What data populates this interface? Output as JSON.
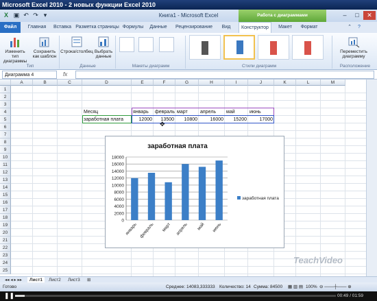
{
  "player": {
    "title": "Microsoft Excel 2010 - 2 новых функции Excel 2010",
    "progress": 0.03,
    "time_current": "00:49",
    "time_total": "01:59",
    "watermark": "TeachVideo"
  },
  "window": {
    "title": "Книга1 - Microsoft Excel",
    "context_tab": "Работа с диаграммами"
  },
  "tabs": {
    "file": "Файл",
    "items": [
      "Главная",
      "Вставка",
      "Разметка страницы",
      "Формулы",
      "Данные",
      "Рецензирование",
      "Вид",
      "Конструктор",
      "Макет",
      "Формат"
    ],
    "active": "Конструктор"
  },
  "ribbon": {
    "change_type": "Изменить тип диаграммы",
    "save_template": "Сохранить как шаблон",
    "row_col": "Строка/столбец",
    "select_data": "Выбрать данные",
    "move_chart": "Переместить диаграмму",
    "group_type": "Тип",
    "group_data": "Данные",
    "group_layouts": "Макеты диаграмм",
    "group_styles": "Стили диаграмм",
    "group_location": "Расположение",
    "style_colors": [
      "#555555",
      "#3a78c0",
      "#d9534a",
      "#d9534a"
    ]
  },
  "formula_bar": {
    "name_box": "Диаграмма 4",
    "fx": "fx",
    "value": ""
  },
  "grid": {
    "columns": [
      "A",
      "B",
      "C",
      "D",
      "E",
      "F",
      "G",
      "H",
      "I",
      "J",
      "K",
      "L",
      "M"
    ],
    "rows": [
      "1",
      "2",
      "3",
      "4",
      "5",
      "6",
      "7",
      "8",
      "9",
      "10",
      "11",
      "12",
      "13",
      "14",
      "15",
      "16",
      "17",
      "18",
      "19",
      "20",
      "21",
      "22",
      "23",
      "24",
      "25"
    ],
    "cells": {
      "label_month": "Месяц",
      "label_salary": "заработная плата",
      "months": [
        "январь",
        "февраль",
        "март",
        "апрель",
        "май",
        "июнь"
      ],
      "values": [
        "12000",
        "13500",
        "10800",
        "16000",
        "15200",
        "17000"
      ]
    }
  },
  "chart_data": {
    "type": "bar",
    "title": "заработная плата",
    "categories": [
      "январь",
      "февраль",
      "март",
      "апрель",
      "май",
      "июнь"
    ],
    "series": [
      {
        "name": "заработная плата",
        "values": [
          12000,
          13500,
          10800,
          16000,
          15200,
          17000
        ]
      }
    ],
    "ylim": [
      0,
      18000
    ],
    "yticks": [
      "0",
      "2000",
      "4000",
      "6000",
      "8000",
      "10000",
      "12000",
      "14000",
      "16000",
      "18000"
    ],
    "grid": true,
    "legend": "right",
    "bar_color": "#3c7fc7"
  },
  "sheets": {
    "tabs": [
      "Лист1",
      "Лист2",
      "Лист3"
    ],
    "active": "Лист1"
  },
  "status": {
    "ready": "Готово",
    "average": "Среднее: 14083,333333",
    "count": "Количество: 14",
    "sum": "Сумма: 84500",
    "zoom": "100%"
  }
}
